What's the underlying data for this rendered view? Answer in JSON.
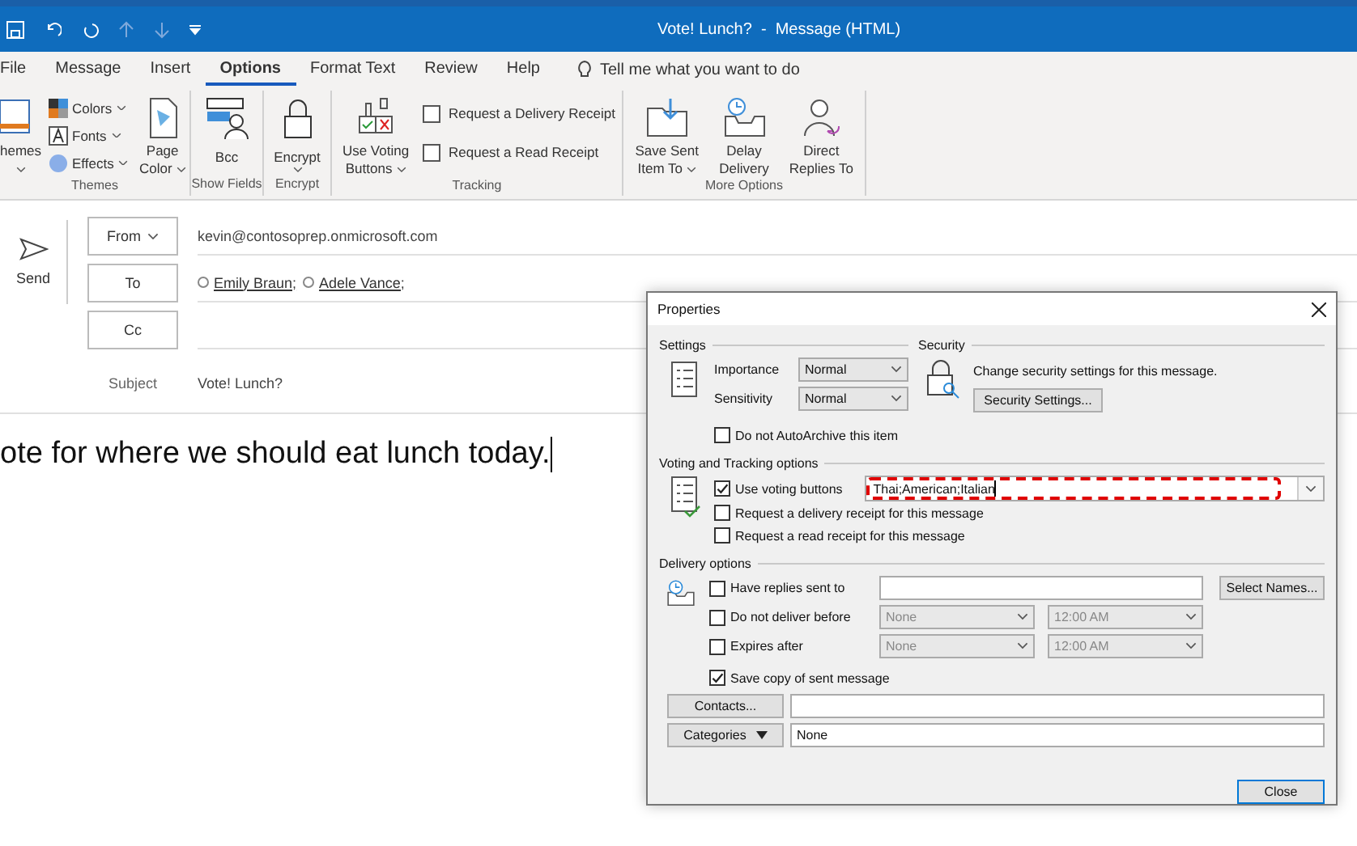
{
  "window": {
    "title": "Vote! Lunch?  -  Message (HTML)"
  },
  "tabs": [
    {
      "label": "File",
      "selected": false
    },
    {
      "label": "Message",
      "selected": false
    },
    {
      "label": "Insert",
      "selected": false
    },
    {
      "label": "Options",
      "selected": true
    },
    {
      "label": "Format Text",
      "selected": false
    },
    {
      "label": "Review",
      "selected": false
    },
    {
      "label": "Help",
      "selected": false
    }
  ],
  "tell_me": "Tell me what you want to do",
  "ribbon": {
    "themes": {
      "label": "Themes",
      "themes_button": "hemes",
      "small": [
        {
          "label": "Colors",
          "kind": "colors"
        },
        {
          "label": "Fonts",
          "kind": "fonts"
        },
        {
          "label": "Effects",
          "kind": "effects"
        }
      ],
      "page_color": "Page Color"
    },
    "show_fields": {
      "label": "Show Fields",
      "bcc": "Bcc"
    },
    "encrypt": {
      "label": "Encrypt",
      "button": "Encrypt"
    },
    "tracking": {
      "label": "Tracking",
      "voting": "Use Voting Buttons",
      "checks": [
        {
          "label": "Request a Delivery Receipt",
          "checked": false
        },
        {
          "label": "Request a Read Receipt",
          "checked": false
        }
      ]
    },
    "more_options": {
      "label": "More Options",
      "buttons": [
        {
          "label": "Save Sent Item To",
          "kind": "save",
          "dropdown": true
        },
        {
          "label": "Delay Delivery",
          "kind": "delay",
          "dropdown": false
        },
        {
          "label": "Direct Replies To",
          "kind": "direct",
          "dropdown": false
        }
      ]
    }
  },
  "compose": {
    "send": "Send",
    "from": {
      "label": "From",
      "value": "kevin@contosoprep.onmicrosoft.com"
    },
    "to": {
      "label": "To",
      "recipients": [
        "Emily Braun;",
        "Adele Vance;"
      ]
    },
    "cc": {
      "label": "Cc"
    },
    "subject": {
      "label": "Subject",
      "value": "Vote! Lunch?"
    },
    "body": "ote for where we should eat lunch today."
  },
  "dialog": {
    "title": "Properties",
    "settings": {
      "legend": "Settings",
      "selects": [
        {
          "label": "Importance",
          "value": "Normal"
        },
        {
          "label": "Sensitivity",
          "value": "Normal"
        }
      ],
      "autoarchive": {
        "label": "Do not AutoArchive this item",
        "checked": false
      }
    },
    "security": {
      "legend": "Security",
      "text": "Change security settings for this message.",
      "button": "Security Settings..."
    },
    "voting": {
      "legend": "Voting and Tracking options",
      "checks": [
        {
          "label": "Use voting buttons",
          "checked": true
        },
        {
          "label": "Request a delivery receipt for this message",
          "checked": false
        },
        {
          "label": "Request a read receipt for this message",
          "checked": false
        }
      ],
      "choices": "Thai;American;Italian"
    },
    "delivery": {
      "legend": "Delivery options",
      "replies": {
        "label": "Have replies sent to",
        "checked": false,
        "button": "Select Names..."
      },
      "timed": [
        {
          "label": "Do not deliver before",
          "checked": false,
          "date": "None",
          "time": "12:00 AM"
        },
        {
          "label": "Expires after",
          "checked": false,
          "date": "None",
          "time": "12:00 AM"
        }
      ],
      "save_copy": {
        "label": "Save copy of sent message",
        "checked": true
      }
    },
    "contacts": {
      "button": "Contacts..."
    },
    "categories": {
      "button": "Categories",
      "value": "None"
    },
    "close_button": "Close"
  }
}
